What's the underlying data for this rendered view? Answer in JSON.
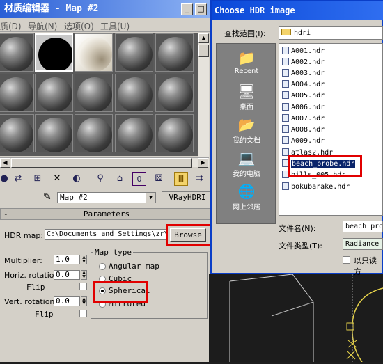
{
  "material_editor": {
    "title": "材质编辑器 - Map #2",
    "title_buttons": [
      "_",
      "□"
    ],
    "menu": [
      "质(D)",
      "导航(N)",
      "选项(O)",
      "工具(U)"
    ],
    "tool_icons": [
      "sphere-icon",
      "pick-icon",
      "assign-icon",
      "delete-icon",
      "copy-icon",
      "material-id-icon",
      "unique-icon",
      "show-map-icon",
      "background-icon",
      "go-parent-icon",
      "go-sibling-icon"
    ],
    "map_name": "Map #2",
    "map_type": "VRayHDRI",
    "rollout": {
      "sign": "-",
      "title": "Parameters"
    },
    "hdr_map_label": "HDR map:",
    "hdr_map_path": "C:\\Documents and Settings\\zr\\M",
    "browse_label": "Browse",
    "multiplier": {
      "label": "Multiplier:",
      "value": "1.0"
    },
    "horiz_rotation": {
      "label": "Horiz. rotation:",
      "value": "0.0"
    },
    "flip1": "Flip",
    "vert_rotation": {
      "label": "Vert. rotation:",
      "value": "0.0"
    },
    "flip2": "Flip",
    "map_type_group": {
      "title": "Map type",
      "options": [
        "Angular map",
        "Cubic",
        "Spherical",
        "Mirrored"
      ],
      "selected": "Spherical"
    }
  },
  "dialog": {
    "title": "Choose HDR image",
    "look_in_label": "查找范围(I):",
    "look_in_value": "hdri",
    "places": [
      "Recent",
      "桌面",
      "我的文档",
      "我的电脑",
      "网上邻居"
    ],
    "files": [
      "A001.hdr",
      "A002.hdr",
      "A003.hdr",
      "A004.hdr",
      "A005.hdr",
      "A006.hdr",
      "A007.hdr",
      "A008.hdr",
      "A009.hdr",
      "atlas2.hdr",
      "beach_probe.hdr",
      "bills_005.hdr",
      "bokubarake.hdr"
    ],
    "selected_file": "beach_probe.hdr",
    "filename_label": "文件名(N):",
    "filename_value": "beach_probe",
    "filetype_label": "文件类型(T):",
    "filetype_value": "Radiance H",
    "readonly_label": "以只读方"
  },
  "colors": {
    "highlight": "#e10000",
    "title_blue": "#0a48d8",
    "selection": "#0a246a"
  }
}
